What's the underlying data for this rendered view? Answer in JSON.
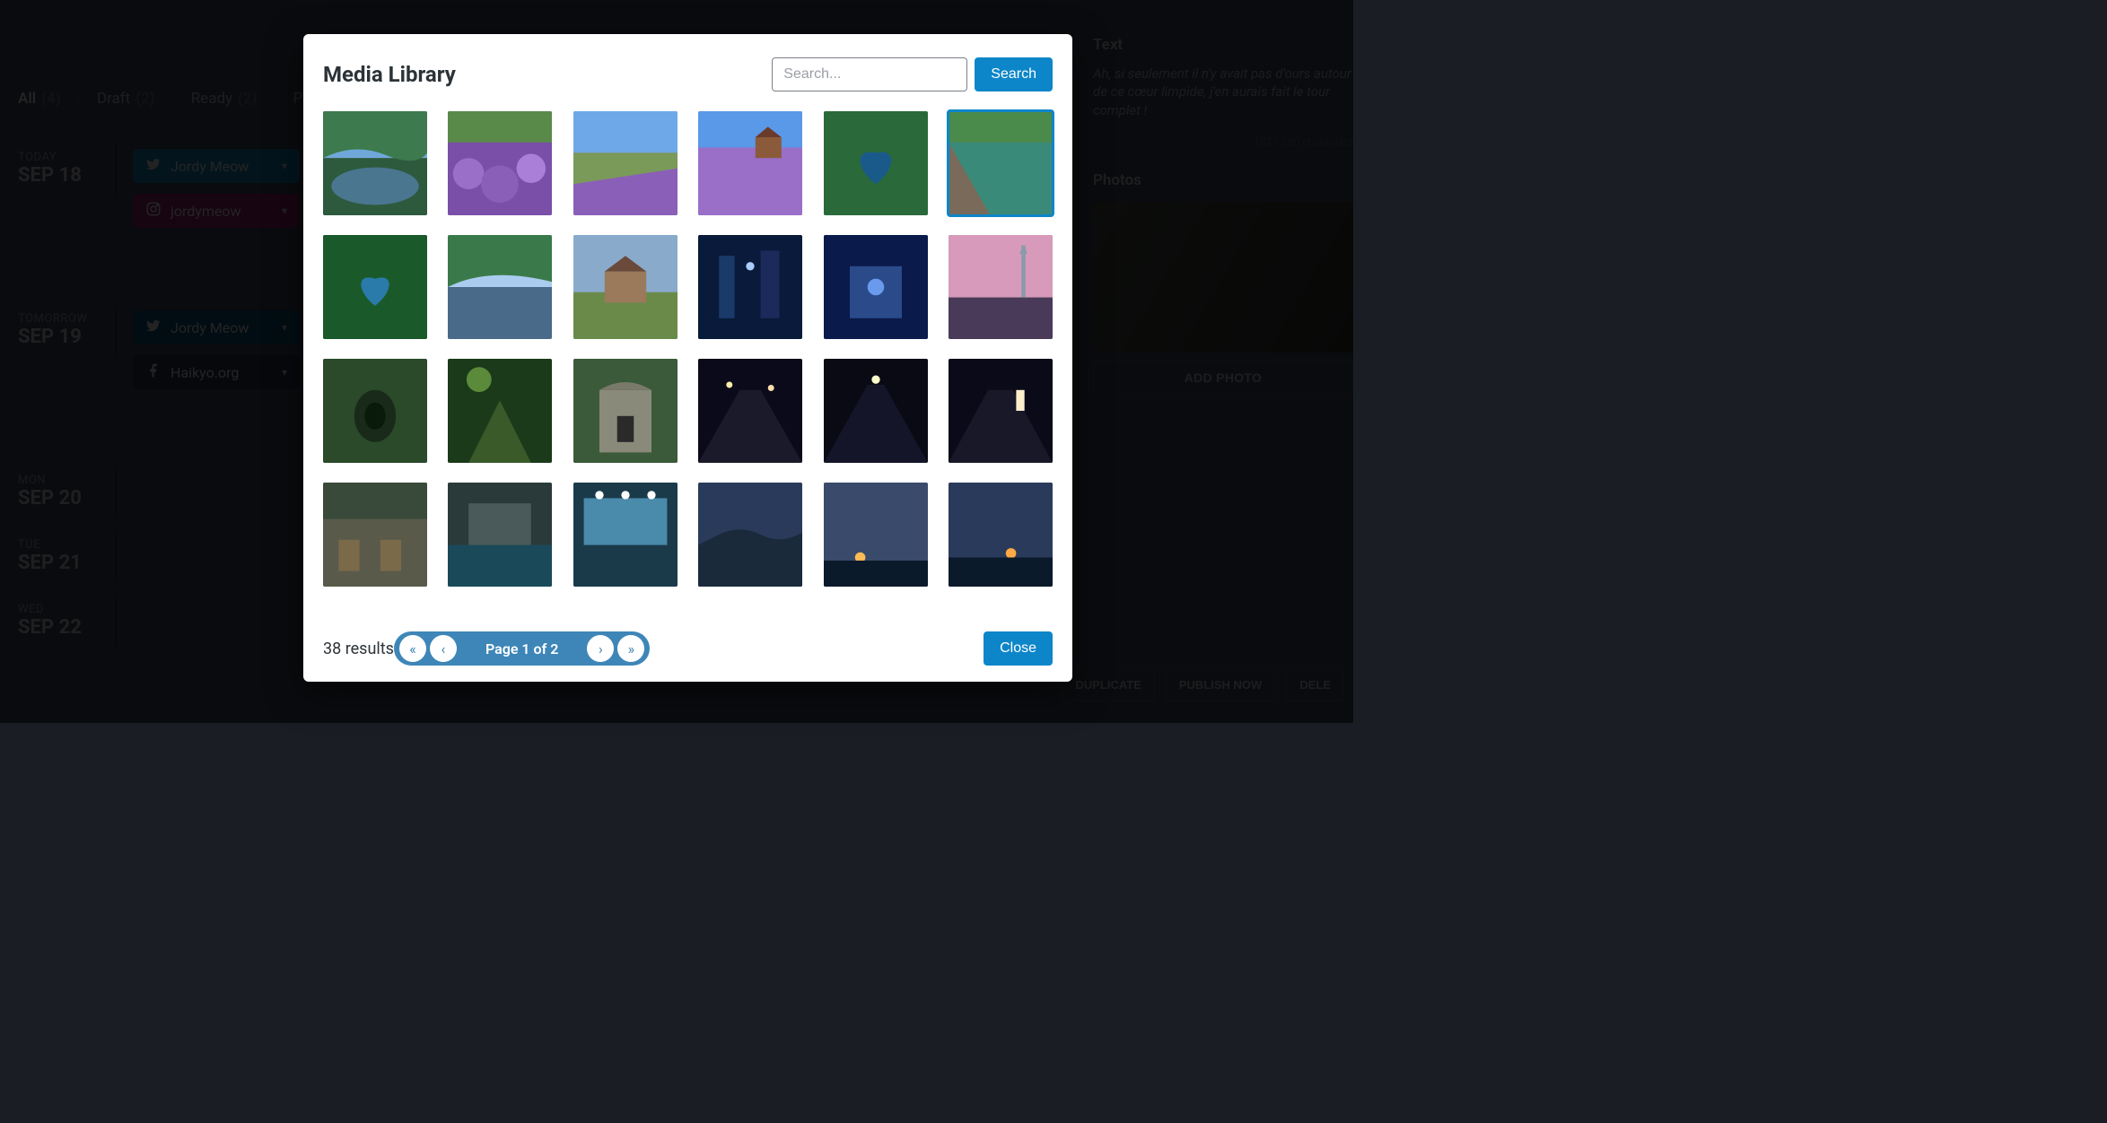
{
  "bg": {
    "tabs": [
      {
        "label": "All",
        "count": "(4)",
        "active": true
      },
      {
        "label": "Draft",
        "count": "(2)",
        "active": false
      },
      {
        "label": "Ready",
        "count": "(2)",
        "active": false
      },
      {
        "label": "Pub",
        "count": "",
        "active": false
      }
    ],
    "days": [
      {
        "label": "TODAY",
        "date": "SEP 18",
        "pills": [
          {
            "type": "twitter",
            "label": "Jordy Meow"
          },
          {
            "type": "instagram",
            "label": "jordymeow"
          }
        ]
      },
      {
        "label": "TOMORROW",
        "date": "SEP 19",
        "pills": [
          {
            "type": "twitter2",
            "label": "Jordy Meow"
          },
          {
            "type": "facebook",
            "label": "Haikyo.org"
          }
        ]
      },
      {
        "label": "MON",
        "date": "SEP 20",
        "pills": []
      },
      {
        "label": "TUE",
        "date": "SEP 21",
        "pills": []
      },
      {
        "label": "WED",
        "date": "SEP 22",
        "pills": []
      }
    ],
    "right": {
      "text_title": "Text",
      "paragraph": "Ah, si seulement il n'y avait pas d'ours autour de ce cœur limpide, j'en aurais fait le tour complet !",
      "char_count": "102 / 280 characters",
      "photos_title": "Photos",
      "add_photo": "ADD PHOTO",
      "actions": [
        "DUPLICATE",
        "PUBLISH NOW",
        "DELE"
      ]
    }
  },
  "modal": {
    "title": "Media Library",
    "search_placeholder": "Search...",
    "search_button": "Search",
    "results": "38 results",
    "page_label": "Page 1 of 2",
    "close": "Close",
    "selected_index": 5,
    "thumbs": [
      {
        "g": "lake_green"
      },
      {
        "g": "lavender_close"
      },
      {
        "g": "lavender_field"
      },
      {
        "g": "lavender_house"
      },
      {
        "g": "heart_lake"
      },
      {
        "g": "rock_water"
      },
      {
        "g": "heart_lake2"
      },
      {
        "g": "lake_reflection"
      },
      {
        "g": "barn"
      },
      {
        "g": "night_alley_blue"
      },
      {
        "g": "shop_blue"
      },
      {
        "g": "tower_sunset"
      },
      {
        "g": "tunnel_green"
      },
      {
        "g": "forest_rock"
      },
      {
        "g": "stone_building"
      },
      {
        "g": "night_street1"
      },
      {
        "g": "night_street2"
      },
      {
        "g": "night_street3"
      },
      {
        "g": "classroom"
      },
      {
        "g": "bathhouse"
      },
      {
        "g": "tile_bath"
      },
      {
        "g": "sunset1"
      },
      {
        "g": "sunset2"
      },
      {
        "g": "sunset3"
      }
    ]
  }
}
